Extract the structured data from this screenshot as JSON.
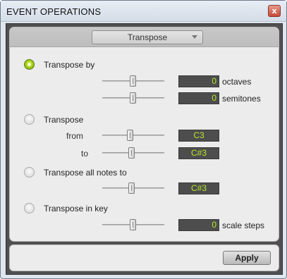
{
  "window": {
    "title": "EVENT OPERATIONS",
    "close_glyph": "x"
  },
  "operation_selector": {
    "selected": "Transpose"
  },
  "transpose_by": {
    "label": "Transpose by",
    "selected": true,
    "octaves": {
      "value": "0",
      "unit": "octaves"
    },
    "semitones": {
      "value": "0",
      "unit": "semitones"
    }
  },
  "transpose_range": {
    "label": "Transpose",
    "selected": false,
    "from_label": "from",
    "from_value": "C3",
    "to_label": "to",
    "to_value": "C#3"
  },
  "transpose_all": {
    "label": "Transpose all notes to",
    "selected": false,
    "value": "C#3"
  },
  "transpose_in_key": {
    "label": "Transpose in key",
    "selected": false,
    "value": "0",
    "unit": "scale steps"
  },
  "footer": {
    "apply_label": "Apply"
  },
  "colors": {
    "field_bg": "#4d4d4d",
    "field_text": "#b8ea2a",
    "radio_on": "#a7d31e",
    "frame": "#505050",
    "close_button": "#c64b39"
  }
}
